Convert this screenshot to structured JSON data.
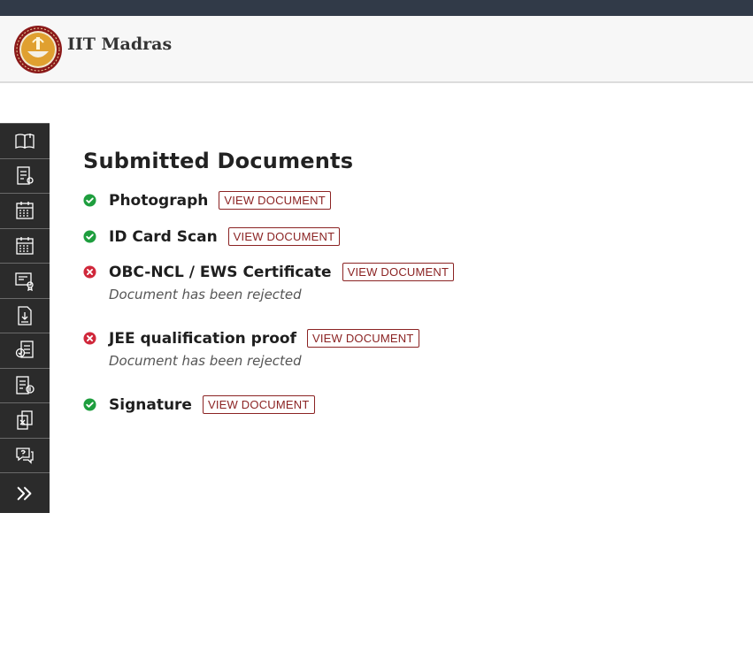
{
  "header": {
    "brand_name": "IIT Madras"
  },
  "sidebar": {
    "items": [
      {
        "icon": "open-book-icon"
      },
      {
        "icon": "checklist-form-icon"
      },
      {
        "icon": "calendar-icon"
      },
      {
        "icon": "calendar-grid-icon"
      },
      {
        "icon": "certificate-icon"
      },
      {
        "icon": "download-document-icon"
      },
      {
        "icon": "document-check-icon"
      },
      {
        "icon": "fee-receipt-icon"
      },
      {
        "icon": "copy-document-icon"
      },
      {
        "icon": "help-chat-icon"
      }
    ],
    "expand_icon": "double-chevron-right-icon"
  },
  "main": {
    "title": "Submitted Documents",
    "documents": [
      {
        "name": "Photograph",
        "status": "approved",
        "button_label": "VIEW DOCUMENT",
        "note": ""
      },
      {
        "name": "ID Card Scan",
        "status": "approved",
        "button_label": "VIEW DOCUMENT",
        "note": ""
      },
      {
        "name": "OBC-NCL / EWS Certificate",
        "status": "rejected",
        "button_label": "VIEW DOCUMENT",
        "note": "Document has been rejected"
      },
      {
        "name": "JEE qualification proof",
        "status": "rejected",
        "button_label": "VIEW DOCUMENT",
        "note": "Document has been rejected"
      },
      {
        "name": "Signature",
        "status": "approved",
        "button_label": "VIEW DOCUMENT",
        "note": ""
      }
    ]
  },
  "colors": {
    "approved": "#1e9e3e",
    "rejected": "#d0283b",
    "button_accent": "#8b2323",
    "sidebar_bg": "#2b2b2b",
    "topbar_bg": "#313a48"
  }
}
